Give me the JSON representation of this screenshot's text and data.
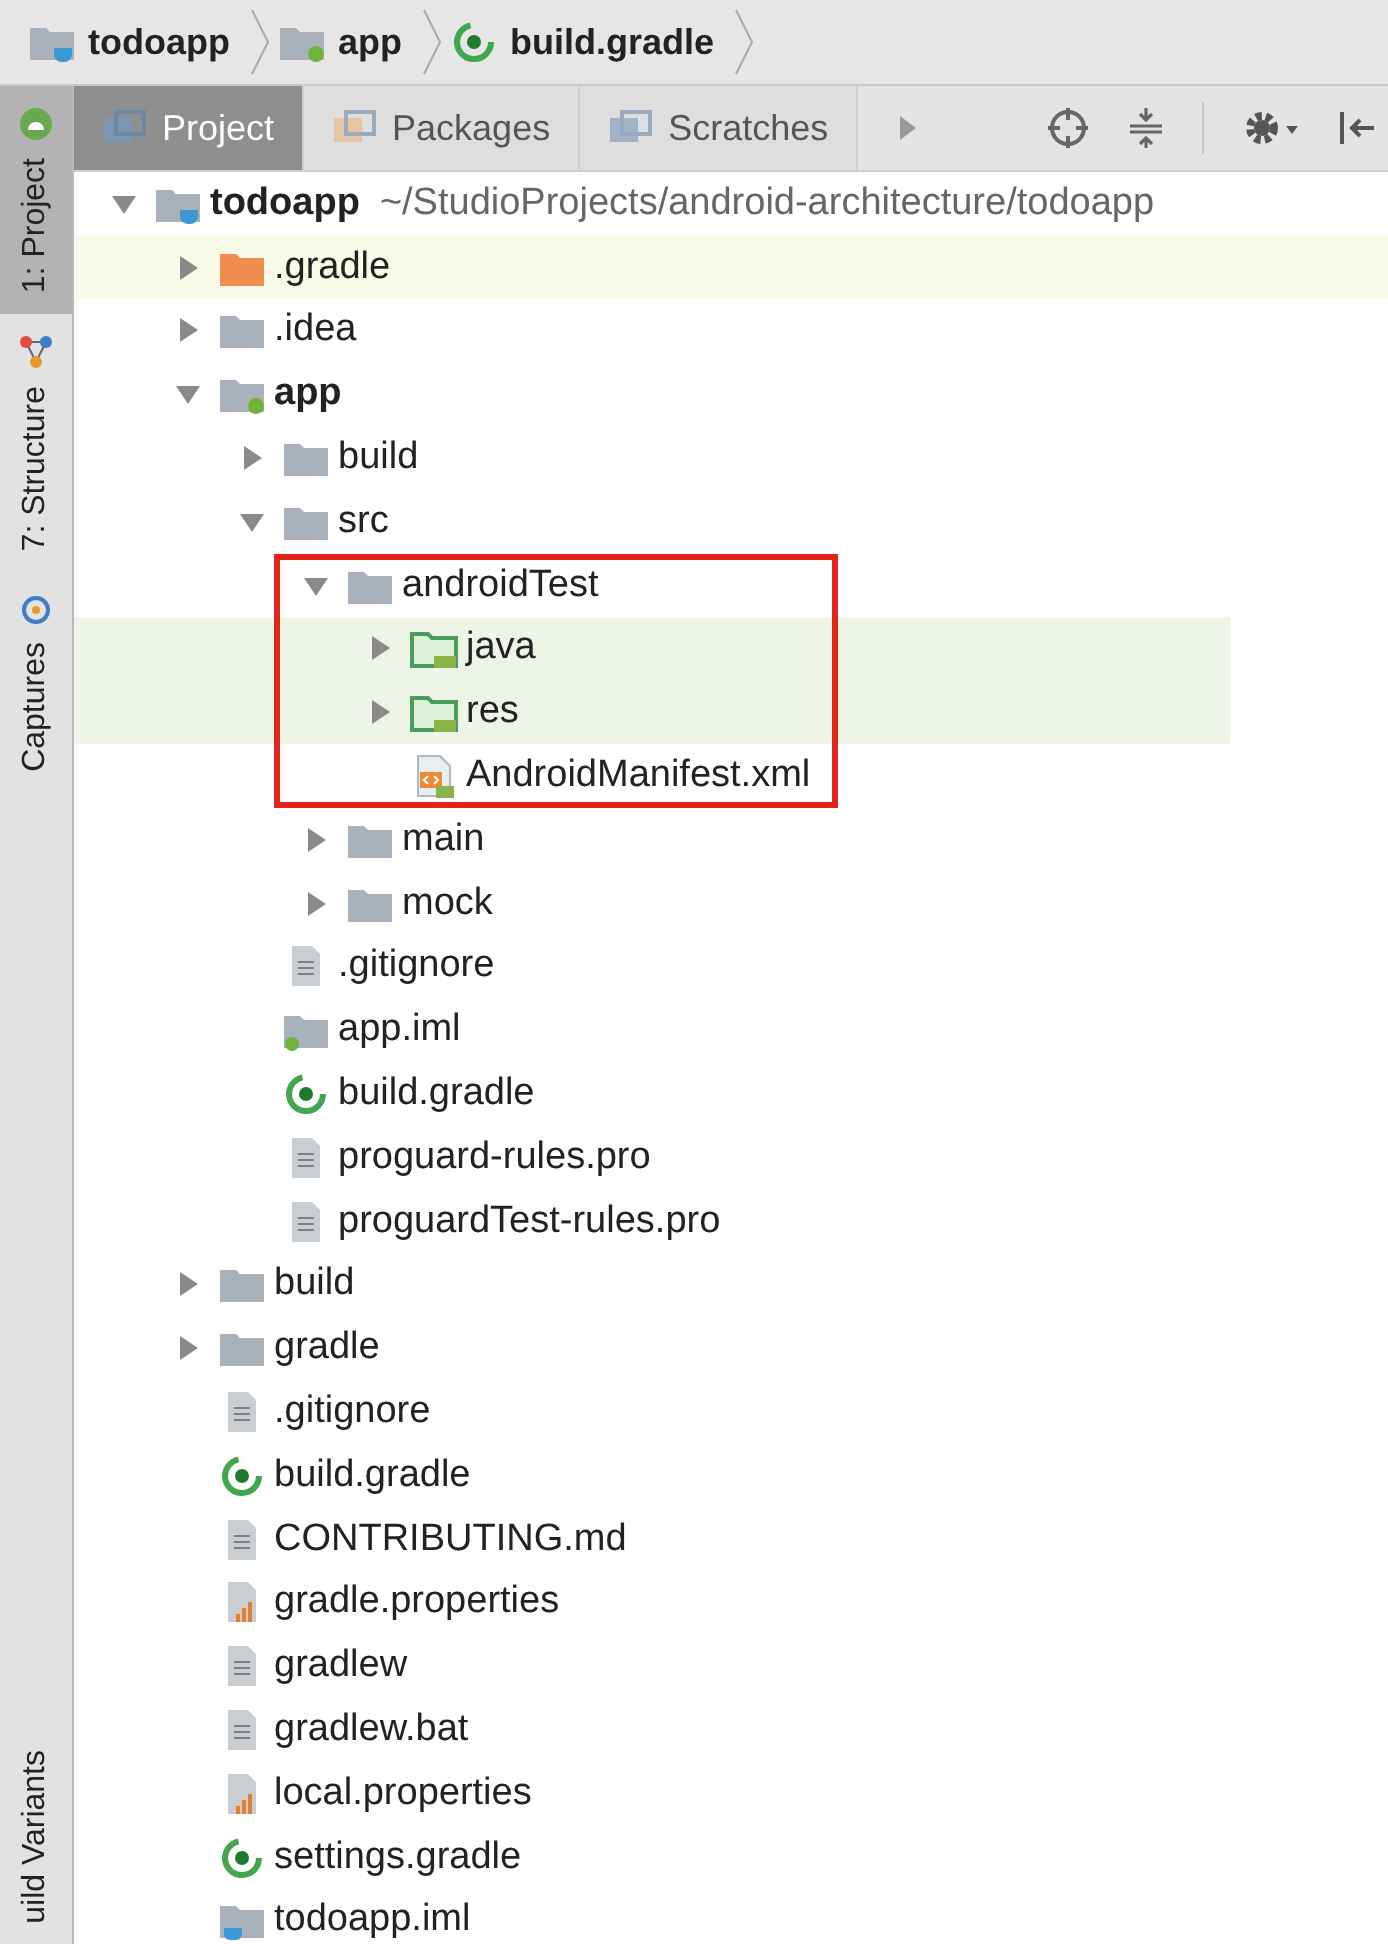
{
  "breadcrumbs": [
    {
      "label": "todoapp",
      "kind": "project-folder"
    },
    {
      "label": "app",
      "kind": "module-folder"
    },
    {
      "label": "build.gradle",
      "kind": "gradle-file"
    }
  ],
  "side_tabs": [
    {
      "label": "1: Project",
      "kind": "android",
      "selected": true
    },
    {
      "label": "7: Structure",
      "kind": "structure",
      "selected": false
    },
    {
      "label": "Captures",
      "kind": "captures",
      "selected": false
    }
  ],
  "side_tabs_bottom": [
    {
      "label": "uild Variants",
      "selected": false
    }
  ],
  "view_tabs": [
    {
      "label": "Project",
      "selected": true
    },
    {
      "label": "Packages",
      "selected": false
    },
    {
      "label": "Scratches",
      "selected": false
    }
  ],
  "tree": [
    {
      "label": "todoapp",
      "path": "~/StudioProjects/android-architecture/todoapp",
      "kind": "project-folder",
      "bold": true,
      "expanded": true,
      "children": [
        {
          "label": ".gradle",
          "kind": "excluded-folder",
          "expanded": false,
          "color": "#fafae8"
        },
        {
          "label": ".idea",
          "kind": "folder",
          "expanded": false
        },
        {
          "label": "app",
          "kind": "module-folder",
          "bold": true,
          "expanded": true,
          "children": [
            {
              "label": "build",
              "kind": "folder",
              "expanded": false
            },
            {
              "label": "src",
              "kind": "folder",
              "expanded": true,
              "children": [
                {
                  "label": "androidTest",
                  "kind": "folder",
                  "expanded": true,
                  "outlined": true,
                  "children": [
                    {
                      "label": "java",
                      "kind": "test-folder",
                      "expanded": false,
                      "color": "#eef5e6"
                    },
                    {
                      "label": "res",
                      "kind": "test-folder",
                      "expanded": false,
                      "color": "#eef5e6"
                    },
                    {
                      "label": "AndroidManifest.xml",
                      "kind": "manifest"
                    }
                  ]
                },
                {
                  "label": "main",
                  "kind": "folder",
                  "expanded": false
                },
                {
                  "label": "mock",
                  "kind": "folder",
                  "expanded": false
                }
              ]
            },
            {
              "label": ".gitignore",
              "kind": "text-file"
            },
            {
              "label": "app.iml",
              "kind": "module-file"
            },
            {
              "label": "build.gradle",
              "kind": "gradle-file"
            },
            {
              "label": "proguard-rules.pro",
              "kind": "text-file"
            },
            {
              "label": "proguardTest-rules.pro",
              "kind": "text-file"
            }
          ]
        },
        {
          "label": "build",
          "kind": "folder",
          "expanded": false
        },
        {
          "label": "gradle",
          "kind": "folder",
          "expanded": false
        },
        {
          "label": ".gitignore",
          "kind": "text-file"
        },
        {
          "label": "build.gradle",
          "kind": "gradle-file"
        },
        {
          "label": "CONTRIBUTING.md",
          "kind": "text-file"
        },
        {
          "label": "gradle.properties",
          "kind": "properties-file"
        },
        {
          "label": "gradlew",
          "kind": "text-file"
        },
        {
          "label": "gradlew.bat",
          "kind": "text-file"
        },
        {
          "label": "local.properties",
          "kind": "properties-file"
        },
        {
          "label": "settings.gradle",
          "kind": "gradle-file"
        },
        {
          "label": "todoapp.iml",
          "kind": "project-file"
        }
      ]
    }
  ]
}
